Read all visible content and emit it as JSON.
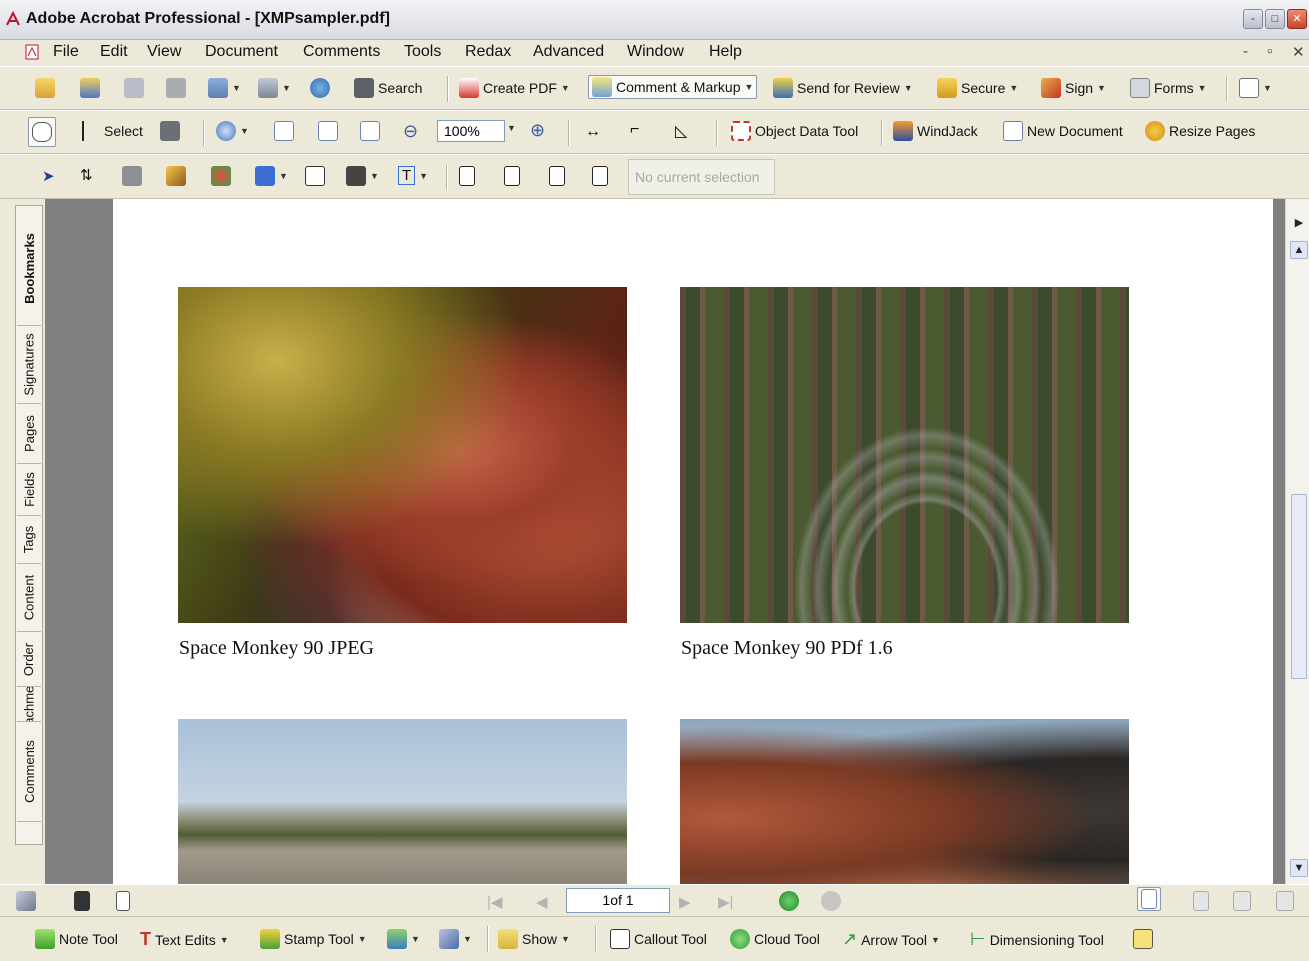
{
  "window": {
    "title": "Adobe Acrobat Professional - [XMPsampler.pdf]",
    "controls": [
      "-",
      "□",
      "✕"
    ]
  },
  "menu": [
    "File",
    "Edit",
    "View",
    "Document",
    "Comments",
    "Tools",
    "Redax",
    "Advanced",
    "Window",
    "Help"
  ],
  "mdi_controls": [
    "-",
    "▫",
    "✕"
  ],
  "toolbar1": {
    "search": "Search",
    "create_pdf": "Create PDF",
    "comment_markup": "Comment & Markup",
    "send_review": "Send for Review",
    "secure": "Secure",
    "sign": "Sign",
    "forms": "Forms"
  },
  "toolbar2": {
    "select": "Select",
    "zoom_value": "100%",
    "object_data_tool": "Object Data Tool",
    "windjack": "WindJack",
    "new_document": "New Document",
    "resize_pages": "Resize Pages"
  },
  "toolbar3": {
    "selection_status": "No current selection"
  },
  "side_tabs": [
    "Bookmarks",
    "Signatures",
    "Pages",
    "Fields",
    "Tags",
    "Content",
    "Order",
    "Attachments",
    "Comments"
  ],
  "document": {
    "captions": [
      "Space Monkey 90  JPEG",
      "Space Monkey 90 PDf 1.6"
    ]
  },
  "nav": {
    "page_indicator": "1of 1"
  },
  "comment_toolbar": {
    "note_tool": "Note Tool",
    "text_edits": "Text Edits",
    "stamp_tool": "Stamp Tool",
    "show": "Show",
    "callout_tool": "Callout Tool",
    "cloud_tool": "Cloud Tool",
    "arrow_tool": "Arrow Tool",
    "dimensioning_tool": "Dimensioning Tool"
  }
}
